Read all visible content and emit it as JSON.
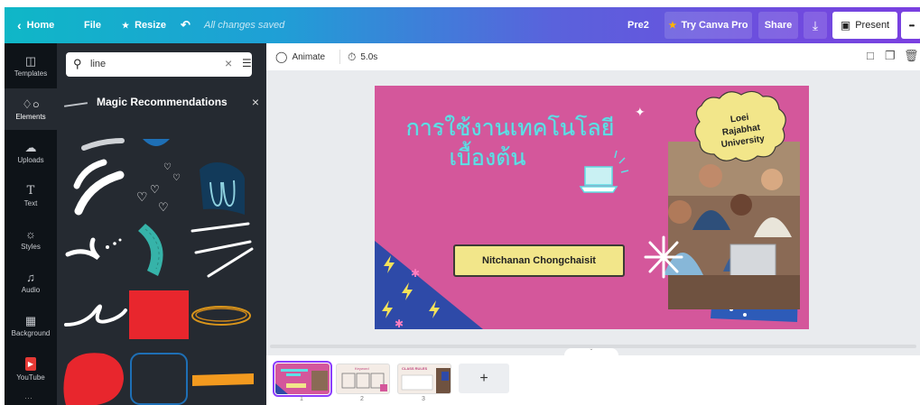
{
  "topbar": {
    "home_label": "Home",
    "file_label": "File",
    "resize_label": "Resize",
    "saved_status": "All changes saved",
    "doc_name": "Pre2",
    "try_pro_label": "Try Canva Pro",
    "share_label": "Share",
    "present_label": "Present",
    "more_label": "•••"
  },
  "sidebar": {
    "items": [
      {
        "label": "Templates",
        "icon": "templates-icon"
      },
      {
        "label": "Elements",
        "icon": "elements-icon"
      },
      {
        "label": "Uploads",
        "icon": "uploads-icon"
      },
      {
        "label": "Text",
        "icon": "text-icon"
      },
      {
        "label": "Styles",
        "icon": "styles-icon"
      },
      {
        "label": "Audio",
        "icon": "audio-icon"
      },
      {
        "label": "Background",
        "icon": "background-icon"
      },
      {
        "label": "YouTube",
        "icon": "youtube-icon"
      }
    ],
    "active": "Elements"
  },
  "panel": {
    "search_value": "line",
    "section_title": "Magic Recommendations",
    "close_symbol": "×"
  },
  "editor": {
    "animate_label": "Animate",
    "duration_label": "5.0s"
  },
  "slide": {
    "thai_line1": "การใช้งานเทคโนโลยี",
    "thai_line2": "เบื้องต้น",
    "author": "Nitchanan Chongchaisit",
    "university_line1": "Loei",
    "university_line2": "Rajabhat",
    "university_line3": "University",
    "bg_color": "#d4579b",
    "title_color": "#5ee0e6",
    "banner_color": "#f2e68a"
  },
  "filmstrip": {
    "pages": [
      {
        "number": "1"
      },
      {
        "number": "2",
        "thumb_title": "Keyword"
      },
      {
        "number": "3",
        "thumb_title": "CLASS RULES"
      }
    ],
    "add_label": "+"
  },
  "colors": {
    "accent": "#8b3dff",
    "rail_bg": "#0e1318",
    "panel_bg": "#252a31"
  }
}
